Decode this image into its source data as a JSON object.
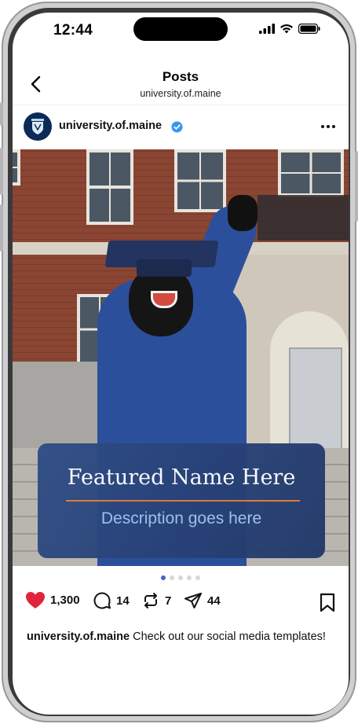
{
  "status_bar": {
    "time": "12:44"
  },
  "header": {
    "title": "Posts",
    "subtitle": "university.of.maine"
  },
  "account": {
    "name": "university.of.maine"
  },
  "post": {
    "featured_name": "Featured Name Here",
    "description": "Description goes here",
    "carousel_total": 5,
    "carousel_active": 1
  },
  "actions": {
    "likes": "1,300",
    "comments": "14",
    "reposts": "7",
    "shares": "44"
  },
  "caption": {
    "username": "university.of.maine",
    "text": " Check out our social media templates!"
  },
  "colors": {
    "like": "#e0243a",
    "verified": "#3797f0",
    "card": "#2f4d86",
    "card_line": "#e07a3a",
    "card_desc": "#9fc6ec"
  }
}
